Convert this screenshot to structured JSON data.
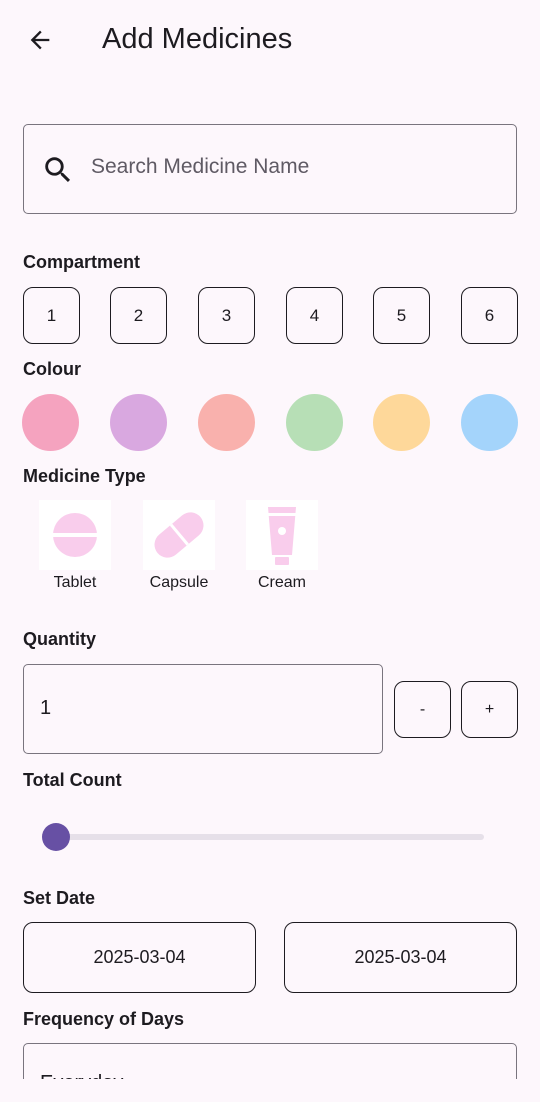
{
  "header": {
    "title": "Add Medicines",
    "back_icon": "arrow-left-icon"
  },
  "search": {
    "placeholder": "Search Medicine Name",
    "icon": "search-icon"
  },
  "compartment": {
    "label": "Compartment",
    "options": [
      "1",
      "2",
      "3",
      "4",
      "5",
      "6"
    ]
  },
  "colour": {
    "label": "Colour",
    "options": [
      "#f5a3bf",
      "#d9a8e0",
      "#f9b1ad",
      "#b7dfb6",
      "#fed89a",
      "#a4d4fb"
    ]
  },
  "medicine_type": {
    "label": "Medicine Type",
    "accent": "#f9cdec",
    "items": [
      {
        "label": "Tablet",
        "icon": "tablet-icon"
      },
      {
        "label": "Capsule",
        "icon": "capsule-icon"
      },
      {
        "label": "Cream",
        "icon": "cream-tube-icon"
      }
    ]
  },
  "quantity": {
    "label": "Quantity",
    "value": "1",
    "decrement_label": "-",
    "increment_label": "+"
  },
  "total_count": {
    "label": "Total Count",
    "slider_fraction": 0.0,
    "accent": "#6750a4"
  },
  "set_date": {
    "label": "Set Date",
    "start": "2025-03-04",
    "end": "2025-03-04"
  },
  "frequency": {
    "label": "Frequency of Days",
    "value": "Everyday"
  }
}
